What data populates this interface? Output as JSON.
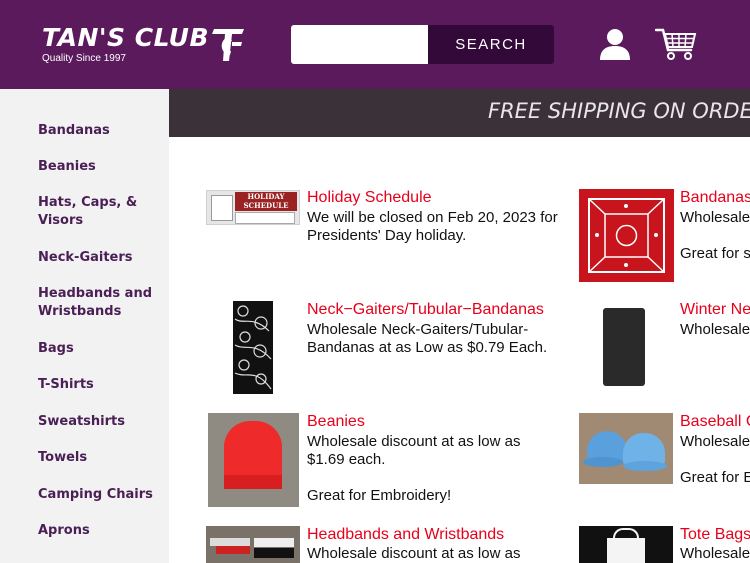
{
  "header": {
    "brand": "TAN'S CLUB",
    "tagline": "Quality Since 1997",
    "search_placeholder": "",
    "search_button": "SEARCH",
    "account_icon": "user-icon",
    "cart_icon": "cart-icon",
    "bg_color": "#5a1a5c"
  },
  "sidebar": {
    "items": [
      {
        "label": "Bandanas"
      },
      {
        "label": "Beanies"
      },
      {
        "label": "Hats, Caps, & Visors"
      },
      {
        "label": "Neck-Gaiters"
      },
      {
        "label": "Headbands and Wristbands"
      },
      {
        "label": "Bags"
      },
      {
        "label": "T-Shirts"
      },
      {
        "label": "Sweatshirts"
      },
      {
        "label": "Towels"
      },
      {
        "label": "Camping Chairs"
      },
      {
        "label": "Aprons"
      }
    ]
  },
  "banner": {
    "text": "FREE SHIPPING ON ORDERS"
  },
  "products": {
    "left": [
      {
        "title": "Holiday Schedule",
        "desc": "We will be closed on Feb 20, 2023 for Presidents' Day holiday.",
        "thumb_text": "HOLIDAY SCHEDULE"
      },
      {
        "title": "Neck−Gaiters/Tubular−Bandanas",
        "desc": "Wholesale Neck-Gaiters/Tubular-Bandanas at as Low as $0.79 Each."
      },
      {
        "title": "Beanies",
        "desc": "Wholesale discount at as low as\n$1.69 each.\n\nGreat for Embroidery!"
      },
      {
        "title": "Headbands and Wristbands",
        "desc": "Wholesale discount at as low as"
      }
    ],
    "right": [
      {
        "title": "Bandanas",
        "desc": "Wholesale\n\nGreat for s"
      },
      {
        "title": "Winter Ne",
        "desc": "Wholesale"
      },
      {
        "title": "Baseball C",
        "desc": "Wholesale\n\nGreat for E"
      },
      {
        "title": "Tote Bags",
        "desc": "Wholesale"
      }
    ]
  },
  "colors": {
    "accent": "#e8001b",
    "nav_text": "#4a1f55",
    "banner_bg": "#3b3139"
  }
}
